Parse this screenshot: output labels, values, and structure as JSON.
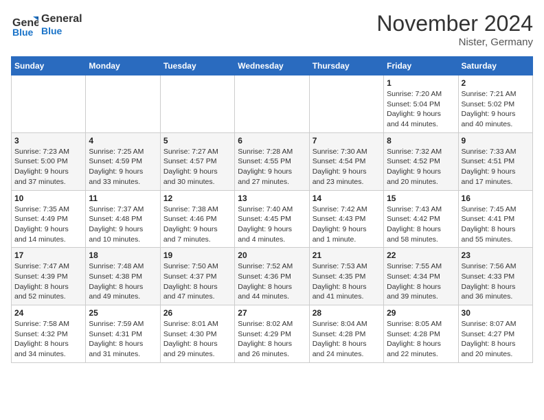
{
  "header": {
    "logo_line1": "General",
    "logo_line2": "Blue",
    "title": "November 2024",
    "location": "Nister, Germany"
  },
  "weekdays": [
    "Sunday",
    "Monday",
    "Tuesday",
    "Wednesday",
    "Thursday",
    "Friday",
    "Saturday"
  ],
  "weeks": [
    [
      {
        "day": "",
        "detail": ""
      },
      {
        "day": "",
        "detail": ""
      },
      {
        "day": "",
        "detail": ""
      },
      {
        "day": "",
        "detail": ""
      },
      {
        "day": "",
        "detail": ""
      },
      {
        "day": "1",
        "detail": "Sunrise: 7:20 AM\nSunset: 5:04 PM\nDaylight: 9 hours\nand 44 minutes."
      },
      {
        "day": "2",
        "detail": "Sunrise: 7:21 AM\nSunset: 5:02 PM\nDaylight: 9 hours\nand 40 minutes."
      }
    ],
    [
      {
        "day": "3",
        "detail": "Sunrise: 7:23 AM\nSunset: 5:00 PM\nDaylight: 9 hours\nand 37 minutes."
      },
      {
        "day": "4",
        "detail": "Sunrise: 7:25 AM\nSunset: 4:59 PM\nDaylight: 9 hours\nand 33 minutes."
      },
      {
        "day": "5",
        "detail": "Sunrise: 7:27 AM\nSunset: 4:57 PM\nDaylight: 9 hours\nand 30 minutes."
      },
      {
        "day": "6",
        "detail": "Sunrise: 7:28 AM\nSunset: 4:55 PM\nDaylight: 9 hours\nand 27 minutes."
      },
      {
        "day": "7",
        "detail": "Sunrise: 7:30 AM\nSunset: 4:54 PM\nDaylight: 9 hours\nand 23 minutes."
      },
      {
        "day": "8",
        "detail": "Sunrise: 7:32 AM\nSunset: 4:52 PM\nDaylight: 9 hours\nand 20 minutes."
      },
      {
        "day": "9",
        "detail": "Sunrise: 7:33 AM\nSunset: 4:51 PM\nDaylight: 9 hours\nand 17 minutes."
      }
    ],
    [
      {
        "day": "10",
        "detail": "Sunrise: 7:35 AM\nSunset: 4:49 PM\nDaylight: 9 hours\nand 14 minutes."
      },
      {
        "day": "11",
        "detail": "Sunrise: 7:37 AM\nSunset: 4:48 PM\nDaylight: 9 hours\nand 10 minutes."
      },
      {
        "day": "12",
        "detail": "Sunrise: 7:38 AM\nSunset: 4:46 PM\nDaylight: 9 hours\nand 7 minutes."
      },
      {
        "day": "13",
        "detail": "Sunrise: 7:40 AM\nSunset: 4:45 PM\nDaylight: 9 hours\nand 4 minutes."
      },
      {
        "day": "14",
        "detail": "Sunrise: 7:42 AM\nSunset: 4:43 PM\nDaylight: 9 hours\nand 1 minute."
      },
      {
        "day": "15",
        "detail": "Sunrise: 7:43 AM\nSunset: 4:42 PM\nDaylight: 8 hours\nand 58 minutes."
      },
      {
        "day": "16",
        "detail": "Sunrise: 7:45 AM\nSunset: 4:41 PM\nDaylight: 8 hours\nand 55 minutes."
      }
    ],
    [
      {
        "day": "17",
        "detail": "Sunrise: 7:47 AM\nSunset: 4:39 PM\nDaylight: 8 hours\nand 52 minutes."
      },
      {
        "day": "18",
        "detail": "Sunrise: 7:48 AM\nSunset: 4:38 PM\nDaylight: 8 hours\nand 49 minutes."
      },
      {
        "day": "19",
        "detail": "Sunrise: 7:50 AM\nSunset: 4:37 PM\nDaylight: 8 hours\nand 47 minutes."
      },
      {
        "day": "20",
        "detail": "Sunrise: 7:52 AM\nSunset: 4:36 PM\nDaylight: 8 hours\nand 44 minutes."
      },
      {
        "day": "21",
        "detail": "Sunrise: 7:53 AM\nSunset: 4:35 PM\nDaylight: 8 hours\nand 41 minutes."
      },
      {
        "day": "22",
        "detail": "Sunrise: 7:55 AM\nSunset: 4:34 PM\nDaylight: 8 hours\nand 39 minutes."
      },
      {
        "day": "23",
        "detail": "Sunrise: 7:56 AM\nSunset: 4:33 PM\nDaylight: 8 hours\nand 36 minutes."
      }
    ],
    [
      {
        "day": "24",
        "detail": "Sunrise: 7:58 AM\nSunset: 4:32 PM\nDaylight: 8 hours\nand 34 minutes."
      },
      {
        "day": "25",
        "detail": "Sunrise: 7:59 AM\nSunset: 4:31 PM\nDaylight: 8 hours\nand 31 minutes."
      },
      {
        "day": "26",
        "detail": "Sunrise: 8:01 AM\nSunset: 4:30 PM\nDaylight: 8 hours\nand 29 minutes."
      },
      {
        "day": "27",
        "detail": "Sunrise: 8:02 AM\nSunset: 4:29 PM\nDaylight: 8 hours\nand 26 minutes."
      },
      {
        "day": "28",
        "detail": "Sunrise: 8:04 AM\nSunset: 4:28 PM\nDaylight: 8 hours\nand 24 minutes."
      },
      {
        "day": "29",
        "detail": "Sunrise: 8:05 AM\nSunset: 4:28 PM\nDaylight: 8 hours\nand 22 minutes."
      },
      {
        "day": "30",
        "detail": "Sunrise: 8:07 AM\nSunset: 4:27 PM\nDaylight: 8 hours\nand 20 minutes."
      }
    ]
  ]
}
